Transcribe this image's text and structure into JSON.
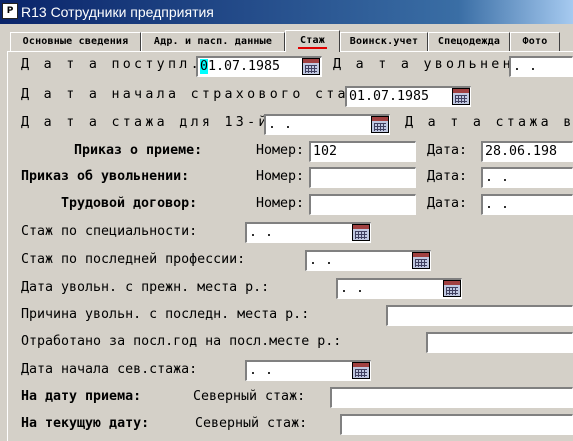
{
  "window": {
    "title": "R13 Сотрудники предприятия"
  },
  "tabs": [
    "Основные сведения",
    "Адр. и пасп. данные",
    "Стаж",
    "Воинск.учет",
    "Спецодежда",
    "Фото"
  ],
  "labels": {
    "hire_date": "Д а т а  поступл.:",
    "dismiss_date": "Д а т а  увольнен:",
    "insurance_start": "Д а т а  начала страхового стажа:",
    "date_13": "Д а т а  стажа для 13-й:",
    "date_right": "Д а т а  стажа вы",
    "order_hire": "Приказ о приеме:",
    "order_dismiss": "Приказ об увольнении:",
    "labor_contract": "Трудовой договор:",
    "number": "Номер:",
    "date": "Дата:",
    "spec_exp": "Стаж по специальности:",
    "last_prof_exp": "Стаж по последней профессии:",
    "prev_dismiss": "Дата увольн. с прежн. места р.:",
    "prev_reason": "Причина увольн. с последн. места р.:",
    "worked_last_year": "Отработано за посл.год на посл.месте р.:",
    "north_start": "Дата начала сев.стажа:",
    "on_hire_date": "На дату приема:",
    "on_current_date": "На текущую дату:",
    "north_exp": "Северный стаж:"
  },
  "values": {
    "hire_date_sel": "0",
    "hire_date_rest": "1.07.1985",
    "dismiss_date": " .  .",
    "insurance_start": "01.07.1985",
    "date_13": " .  .",
    "order_hire_number": "102",
    "order_hire_date": "28.06.198",
    "order_dismiss_number": "",
    "order_dismiss_date": " .  .",
    "contract_number": "",
    "contract_date": " .  .",
    "spec_exp": " .  .",
    "last_prof_exp": " .  .",
    "prev_dismiss": " .  .",
    "prev_reason": "",
    "worked_last_year": "",
    "north_start": " .  .",
    "north_on_hire": "",
    "north_current": ""
  }
}
